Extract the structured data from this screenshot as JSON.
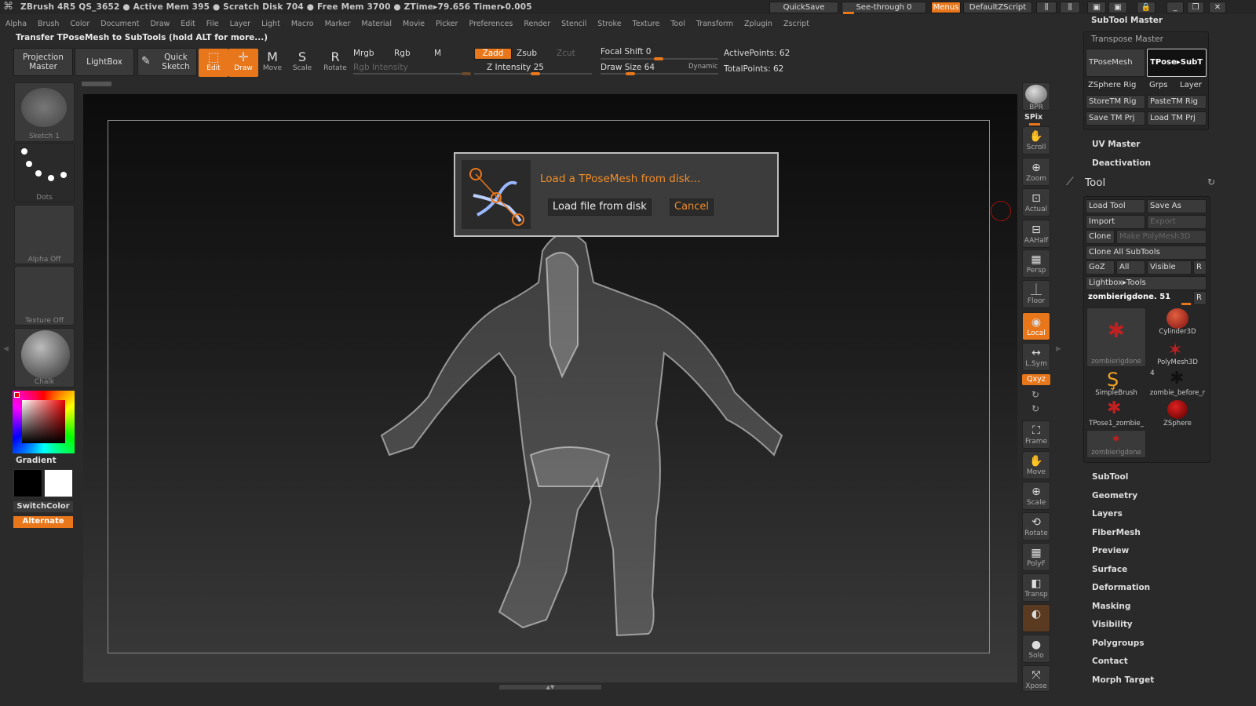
{
  "title_bar": {
    "text": "ZBrush 4R5    QS_3652   ● Active Mem 395 ● Scratch Disk 704 ● Free Mem 3700 ● ZTime▸79.656  Timer▸0.005",
    "quicksave": "QuickSave",
    "see_through": "See-through   0",
    "menus": "Menus",
    "default_zscript": "DefaultZScript",
    "subtool_master": "SubTool Master"
  },
  "menu_bar": [
    "Alpha",
    "Brush",
    "Color",
    "Document",
    "Draw",
    "Edit",
    "File",
    "Layer",
    "Light",
    "Macro",
    "Marker",
    "Material",
    "Movie",
    "Picker",
    "Preferences",
    "Render",
    "Stencil",
    "Stroke",
    "Texture",
    "Tool",
    "Transform",
    "Zplugin",
    "Zscript"
  ],
  "note": "Transfer TPoseMesh to SubTools (hold ALT for more...)",
  "toolbar": {
    "projection_master": "Projection Master",
    "lightbox": "LightBox",
    "quick_sketch": "Quick Sketch",
    "edit": "Edit",
    "draw": "Draw",
    "move": "Move",
    "scale": "Scale",
    "rotate": "Rotate",
    "mrgb": "Mrgb",
    "rgb": "Rgb",
    "m": "M",
    "rgb_intensity": "Rgb Intensity",
    "zadd": "Zadd",
    "zsub": "Zsub",
    "zcut": "Zcut",
    "z_intensity": "Z Intensity 25",
    "focal_shift": "Focal Shift 0",
    "draw_size": "Draw Size 64",
    "dynamic": "Dynamic",
    "active_points": "ActivePoints: 62",
    "total_points": "TotalPoints: 62"
  },
  "left_panel": {
    "sketch": "Sketch 1",
    "dots": "Dots",
    "alpha": "Alpha Off",
    "texture": "Texture Off",
    "chalk": "Chalk",
    "gradient": "Gradient",
    "switch_color": "SwitchColor",
    "alternate": "Alternate"
  },
  "dialog": {
    "message": "Load a TPoseMesh from disk...",
    "load": "Load file from disk",
    "cancel": "Cancel"
  },
  "right_icons": {
    "bpr": "BPR",
    "spix": "SPix",
    "scroll": "Scroll",
    "zoom": "Zoom",
    "actual": "Actual",
    "aahalf": "AAHalf",
    "persp": "Persp",
    "floor": "Floor",
    "local": "Local",
    "lsym": "L.Sym",
    "xyz": "Qxyz",
    "frame": "Frame",
    "move": "Move",
    "scale": "Scale",
    "rotate": "Rotate",
    "polyf": "PolyF",
    "transp": "Transp",
    "solo": "Solo",
    "xpose": "Xpose"
  },
  "right_panel": {
    "transpose_master": "Transpose Master",
    "tposemesh": "TPoseMesh",
    "tpose_subt": "TPose▸SubT",
    "zsphere_rig": "ZSphere Rig",
    "grps": "Grps",
    "layer": "Layer",
    "storetm_rig": "StoreTM Rig",
    "pastetm_rig": "PasteTM Rig",
    "save_tm_prj": "Save TM Prj",
    "load_tm_prj": "Load TM Prj",
    "uv_master": "UV Master",
    "deactivation": "Deactivation",
    "tool_title": "Tool",
    "load_tool": "Load Tool",
    "save_as": "Save As",
    "import": "Import",
    "export": "Export",
    "clone": "Clone",
    "make_polymesh": "Make PolyMesh3D",
    "clone_all": "Clone All SubTools",
    "goz": "GoZ",
    "all": "All",
    "visible": "Visible",
    "r": "R",
    "lightbox_tools": "Lightbox▸Tools",
    "current_tool": "zombierigdone. 51",
    "thumbs": [
      {
        "name": "zombierigdone"
      },
      {
        "name": "Cylinder3D"
      },
      {
        "name": "PolyMesh3D"
      },
      {
        "name": "SimpleBrush"
      },
      {
        "name": "zombie_before_r"
      },
      {
        "name": "TPose1_zombie_"
      },
      {
        "name": "ZSphere"
      },
      {
        "name": "zombierigdone"
      }
    ],
    "count_badge": "4",
    "sections": [
      "SubTool",
      "Geometry",
      "Layers",
      "FiberMesh",
      "Preview",
      "Surface",
      "Deformation",
      "Masking",
      "Visibility",
      "Polygroups",
      "Contact",
      "Morph Target"
    ]
  }
}
